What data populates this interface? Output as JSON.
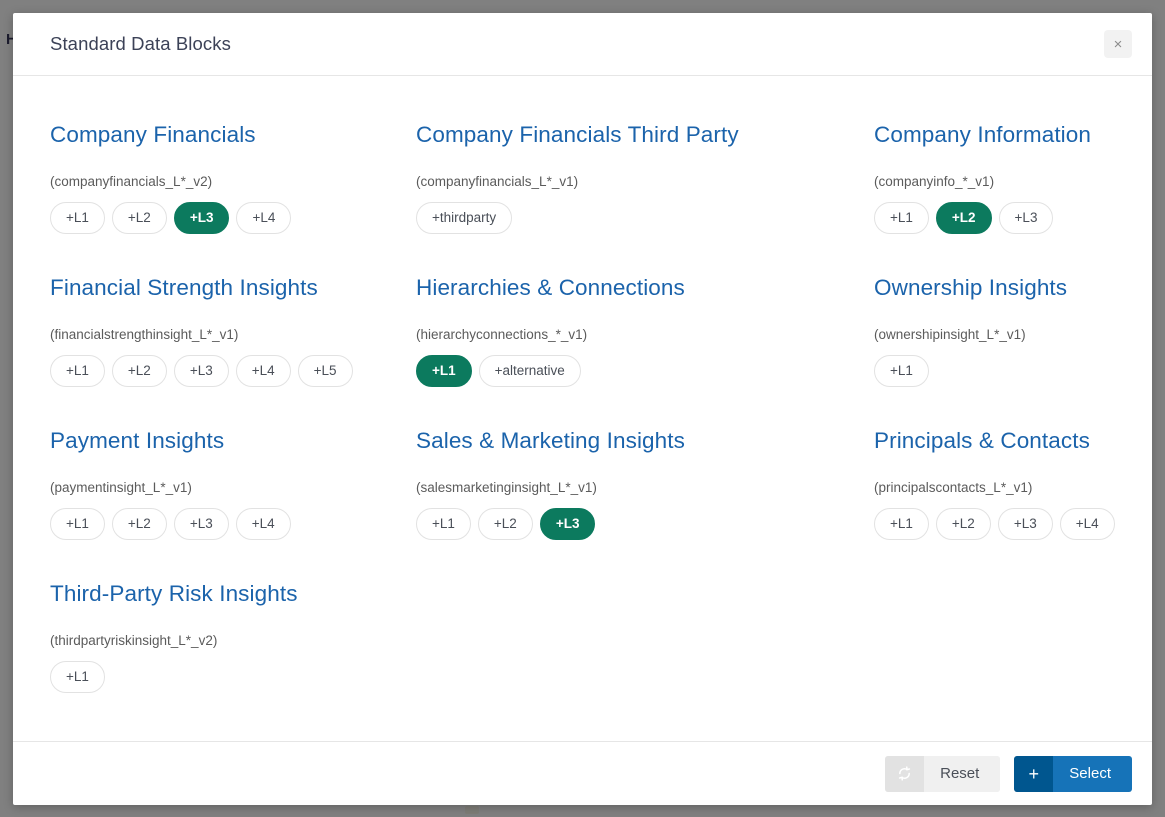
{
  "background": {
    "fragment_text": "H"
  },
  "modal": {
    "title": "Standard Data Blocks",
    "close_label": "×"
  },
  "blocks": [
    {
      "title": "Company Financials",
      "code": "(companyfinancials_L*_v2)",
      "pills": [
        {
          "label": "+L1",
          "selected": false
        },
        {
          "label": "+L2",
          "selected": false
        },
        {
          "label": "+L3",
          "selected": true
        },
        {
          "label": "+L4",
          "selected": false
        }
      ]
    },
    {
      "title": "Company Financials Third Party",
      "code": "(companyfinancials_L*_v1)",
      "pills": [
        {
          "label": "+thirdparty",
          "selected": false
        }
      ]
    },
    {
      "title": "Company Information",
      "code": "(companyinfo_*_v1)",
      "pills": [
        {
          "label": "+L1",
          "selected": false
        },
        {
          "label": "+L2",
          "selected": true
        },
        {
          "label": "+L3",
          "selected": false
        }
      ]
    },
    {
      "title": "Financial Strength Insights",
      "code": "(financialstrengthinsight_L*_v1)",
      "pills": [
        {
          "label": "+L1",
          "selected": false
        },
        {
          "label": "+L2",
          "selected": false
        },
        {
          "label": "+L3",
          "selected": false
        },
        {
          "label": "+L4",
          "selected": false
        },
        {
          "label": "+L5",
          "selected": false
        }
      ]
    },
    {
      "title": "Hierarchies & Connections",
      "code": "(hierarchyconnections_*_v1)",
      "pills": [
        {
          "label": "+L1",
          "selected": true
        },
        {
          "label": "+alternative",
          "selected": false
        }
      ]
    },
    {
      "title": "Ownership Insights",
      "code": "(ownershipinsight_L*_v1)",
      "pills": [
        {
          "label": "+L1",
          "selected": false
        }
      ]
    },
    {
      "title": "Payment Insights",
      "code": "(paymentinsight_L*_v1)",
      "pills": [
        {
          "label": "+L1",
          "selected": false
        },
        {
          "label": "+L2",
          "selected": false
        },
        {
          "label": "+L3",
          "selected": false
        },
        {
          "label": "+L4",
          "selected": false
        }
      ]
    },
    {
      "title": "Sales & Marketing Insights",
      "code": "(salesmarketinginsight_L*_v1)",
      "pills": [
        {
          "label": "+L1",
          "selected": false
        },
        {
          "label": "+L2",
          "selected": false
        },
        {
          "label": "+L3",
          "selected": true
        }
      ]
    },
    {
      "title": "Principals & Contacts",
      "code": "(principalscontacts_L*_v1)",
      "pills": [
        {
          "label": "+L1",
          "selected": false
        },
        {
          "label": "+L2",
          "selected": false
        },
        {
          "label": "+L3",
          "selected": false
        },
        {
          "label": "+L4",
          "selected": false
        }
      ]
    },
    {
      "title": "Third-Party Risk Insights",
      "code": "(thirdpartyriskinsight_L*_v2)",
      "pills": [
        {
          "label": "+L1",
          "selected": false
        }
      ]
    }
  ],
  "footer": {
    "reset_label": "Reset",
    "reset_icon": "refresh-icon",
    "select_label": "Select",
    "select_icon": "plus-icon"
  },
  "colors": {
    "heading_blue": "#1b63ab",
    "selected_green": "#0c7a5e",
    "primary_blue": "#1673b8",
    "primary_blue_dark": "#00568f",
    "overlay_gray": "#808080"
  }
}
